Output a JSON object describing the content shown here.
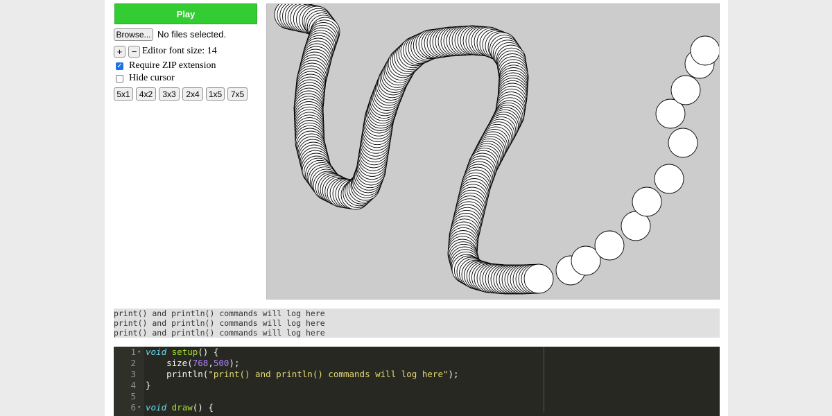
{
  "toolbar": {
    "play_label": "Play",
    "browse_label": "Browse...",
    "file_status": "No files selected.",
    "font_increase": "+",
    "font_decrease": "−",
    "font_label": "Editor font size: 14",
    "zip_checkbox_label": "Require ZIP extension",
    "zip_checked": true,
    "cursor_checkbox_label": "Hide cursor",
    "cursor_checked": false,
    "layouts": [
      "5x1",
      "4x2",
      "3x3",
      "2x4",
      "1x5",
      "7x5"
    ]
  },
  "canvas": {
    "background": "#cccccc",
    "circle_fill": "#ffffff",
    "circle_stroke": "#000000"
  },
  "console": {
    "lines": [
      "print() and println() commands will log here",
      "print() and println() commands will log here",
      "print() and println() commands will log here"
    ]
  },
  "editor": {
    "lines": [
      {
        "n": "1",
        "fold": true,
        "tokens": [
          {
            "t": "void",
            "c": "kw"
          },
          {
            "t": " ",
            "c": "plain"
          },
          {
            "t": "setup",
            "c": "fn"
          },
          {
            "t": "() {",
            "c": "plain"
          }
        ]
      },
      {
        "n": "2",
        "fold": false,
        "tokens": [
          {
            "t": "    size(",
            "c": "plain"
          },
          {
            "t": "768",
            "c": "num"
          },
          {
            "t": ",",
            "c": "plain"
          },
          {
            "t": "500",
            "c": "num"
          },
          {
            "t": ");",
            "c": "plain"
          }
        ]
      },
      {
        "n": "3",
        "fold": false,
        "tokens": [
          {
            "t": "    println(",
            "c": "plain"
          },
          {
            "t": "\"print() and println() commands will log here\"",
            "c": "str"
          },
          {
            "t": ");",
            "c": "plain"
          }
        ]
      },
      {
        "n": "4",
        "fold": false,
        "tokens": [
          {
            "t": "}",
            "c": "plain"
          }
        ]
      },
      {
        "n": "5",
        "fold": false,
        "tokens": []
      },
      {
        "n": "6",
        "fold": true,
        "tokens": [
          {
            "t": "void",
            "c": "kw"
          },
          {
            "t": " ",
            "c": "plain"
          },
          {
            "t": "draw",
            "c": "fn"
          },
          {
            "t": "() {",
            "c": "plain"
          }
        ]
      }
    ]
  }
}
